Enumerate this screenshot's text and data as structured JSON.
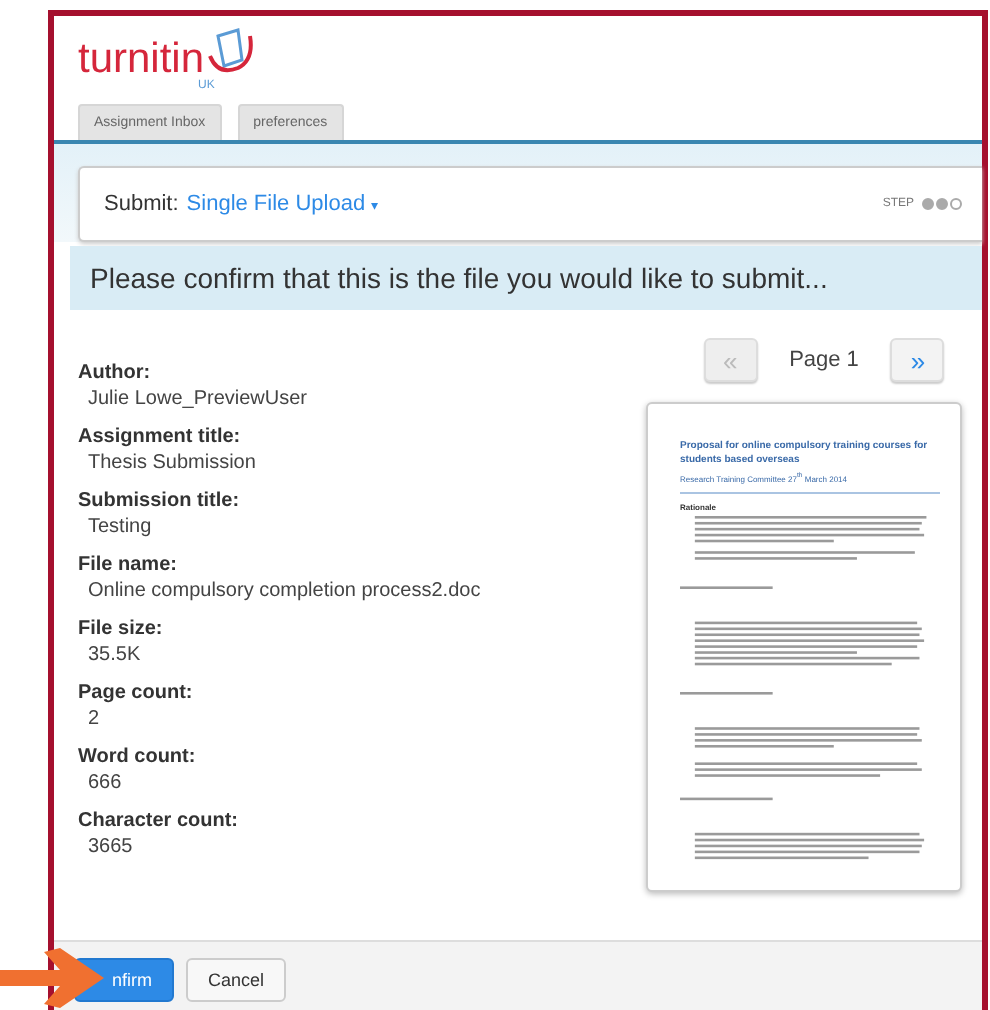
{
  "logo": {
    "name": "turnitin",
    "region": "UK"
  },
  "tabs": [
    {
      "label": "Assignment Inbox",
      "selected": false
    },
    {
      "label": "preferences",
      "selected": false
    }
  ],
  "header": {
    "prefix": "Submit:",
    "mode": "Single File Upload",
    "caret": "▾",
    "step_label": "STEP",
    "steps": [
      {
        "done": true
      },
      {
        "done": true
      },
      {
        "done": false
      }
    ]
  },
  "banner": "Please confirm that this is the file you would like to submit...",
  "details": [
    {
      "label": "Author:",
      "value": "Julie Lowe_PreviewUser"
    },
    {
      "label": "Assignment title:",
      "value": "Thesis Submission"
    },
    {
      "label": "Submission title:",
      "value": "Testing"
    },
    {
      "label": "File name:",
      "value": "Online compulsory completion process2.doc"
    },
    {
      "label": "File size:",
      "value": "35.5K"
    },
    {
      "label": "Page count:",
      "value": "2"
    },
    {
      "label": "Word count:",
      "value": "666"
    },
    {
      "label": "Character count:",
      "value": "3665"
    }
  ],
  "pager": {
    "prev": "«",
    "page": "Page 1",
    "next": "»",
    "prev_disabled": true
  },
  "preview": {
    "title": "Proposal for online compulsory training courses for students based overseas",
    "subtitle": "Research Training Committee 27$^{th}$ March 2014",
    "section": "Rationale"
  },
  "buttons": [
    {
      "label": "nfirm",
      "kind": "primary"
    },
    {
      "label": "Cancel",
      "kind": "secondary"
    }
  ]
}
